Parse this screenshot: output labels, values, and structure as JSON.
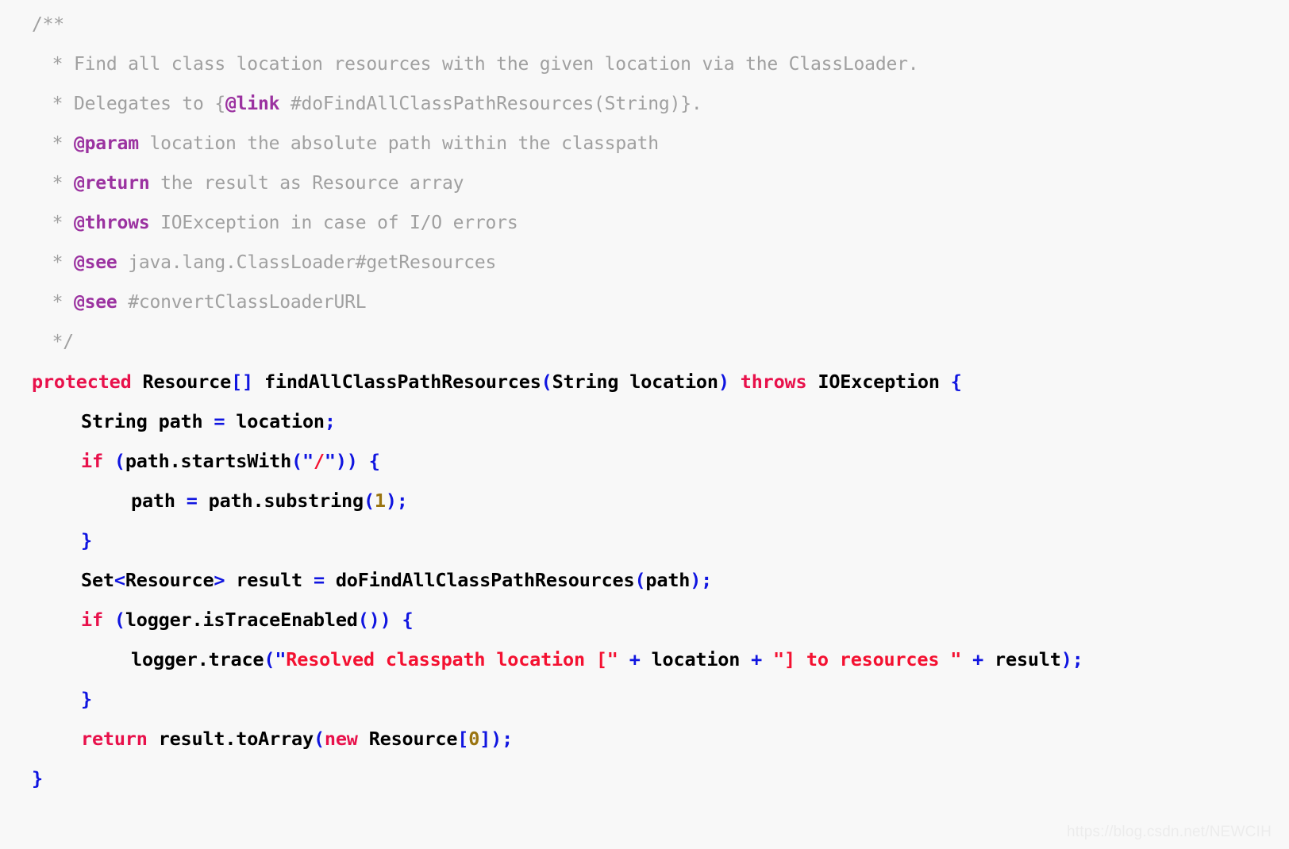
{
  "editor": {
    "language": "java",
    "background_color": "#f8f8f8",
    "colors": {
      "comment": "#a0a0a0",
      "javadoc_tag": "#9b32a0",
      "keyword": "#e8114b",
      "punctuation": "#1015e0",
      "string": "#f41131",
      "number": "#9a7410",
      "identifier": "#000000"
    }
  },
  "code": {
    "lines": [
      {
        "id": "line-1",
        "indent": 0,
        "text": "/**"
      },
      {
        "id": "line-2",
        "indent": 0,
        "text": " * Find all class location resources with the given location via the ClassLoader."
      },
      {
        "id": "line-3",
        "indent": 0,
        "text": " * Delegates to {@link #doFindAllClassPathResources(String)}."
      },
      {
        "id": "line-4",
        "indent": 0,
        "text": " * @param location the absolute path within the classpath"
      },
      {
        "id": "line-5",
        "indent": 0,
        "text": " * @return the result as Resource array"
      },
      {
        "id": "line-6",
        "indent": 0,
        "text": " * @throws IOException in case of I/O errors"
      },
      {
        "id": "line-7",
        "indent": 0,
        "text": " * @see java.lang.ClassLoader#getResources"
      },
      {
        "id": "line-8",
        "indent": 0,
        "text": " * @see #convertClassLoaderURL"
      },
      {
        "id": "line-9",
        "indent": 0,
        "text": " */"
      },
      {
        "id": "line-10",
        "indent": 0,
        "text": "protected Resource[] findAllClassPathResources(String location) throws IOException {"
      },
      {
        "id": "line-11",
        "indent": 1,
        "text": "String path = location;"
      },
      {
        "id": "line-12",
        "indent": 1,
        "text": "if (path.startsWith(\"/\")) {"
      },
      {
        "id": "line-13",
        "indent": 2,
        "text": "path = path.substring(1);"
      },
      {
        "id": "line-14",
        "indent": 1,
        "text": "}"
      },
      {
        "id": "line-15",
        "indent": 1,
        "text": "Set<Resource> result = doFindAllClassPathResources(path);"
      },
      {
        "id": "line-16",
        "indent": 1,
        "text": "if (logger.isTraceEnabled()) {"
      },
      {
        "id": "line-17",
        "indent": 2,
        "text": "logger.trace(\"Resolved classpath location [\" + location + \"] to resources \" + result);"
      },
      {
        "id": "line-18",
        "indent": 1,
        "text": "}"
      },
      {
        "id": "line-19",
        "indent": 1,
        "text": "return result.toArray(new Resource[0]);"
      },
      {
        "id": "line-20",
        "indent": 0,
        "text": "}"
      }
    ],
    "tokens": {
      "javadoc_tags": [
        "@link",
        "@param",
        "@return",
        "@throws",
        "@see"
      ],
      "keywords": [
        "protected",
        "throws",
        "if",
        "return",
        "new"
      ],
      "strings": [
        "\"/\"",
        "\"Resolved classpath location [\"",
        "\"] to resources \""
      ],
      "numbers": [
        "1",
        "0"
      ],
      "types": [
        "Resource",
        "String",
        "IOException",
        "Set"
      ],
      "method_name": "findAllClassPathResources",
      "called_methods": [
        "startsWith",
        "substring",
        "doFindAllClassPathResources",
        "isTraceEnabled",
        "trace",
        "toArray"
      ],
      "variables": [
        "path",
        "location",
        "result",
        "logger"
      ]
    }
  },
  "watermark": {
    "text": "https://blog.csdn.net/NEWCIH"
  }
}
